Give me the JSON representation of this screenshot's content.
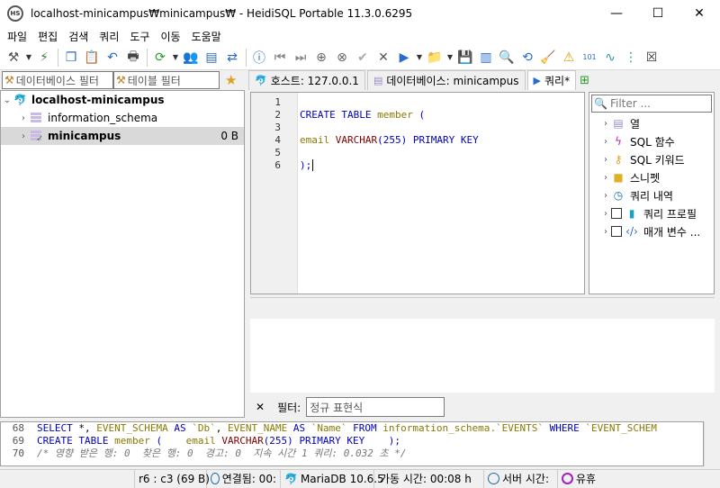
{
  "window": {
    "title": "localhost-minicampus₩minicampus₩ - HeidiSQL Portable 11.3.0.6295",
    "icon_label": "HS"
  },
  "window_controls": {
    "minimize": "—",
    "maximize": "☐",
    "close": "✕"
  },
  "menu": [
    "파일",
    "편집",
    "검색",
    "쿼리",
    "도구",
    "이동",
    "도움말"
  ],
  "left_panel": {
    "db_filter_placeholder": "데이터베이스 필터",
    "table_filter_placeholder": "테이블 필터",
    "tree": {
      "root": "localhost-minicampus",
      "items": [
        {
          "label": "information_schema",
          "size": ""
        },
        {
          "label": "minicampus",
          "size": "0 B"
        }
      ]
    }
  },
  "tabs": [
    {
      "label": "호스트: 127.0.0.1"
    },
    {
      "label": "데이터베이스: minicampus"
    },
    {
      "label": "쿼리*"
    }
  ],
  "editor": {
    "line_numbers": [
      "1",
      "2",
      "3",
      "4",
      "5",
      "6"
    ],
    "line1": "",
    "line2_kw": "CREATE TABLE",
    "line2_id": " member ",
    "line2_paren": "(",
    "line4_id": "email ",
    "line4_type": "VARCHAR",
    "line4_args": "(255) ",
    "line4_kw": "PRIMARY KEY",
    "line6": ");"
  },
  "helper": {
    "filter_placeholder": "Filter ...",
    "items": [
      {
        "label": "열"
      },
      {
        "label": "SQL 함수"
      },
      {
        "label": "SQL 키워드"
      },
      {
        "label": "스니펫"
      },
      {
        "label": "쿼리 내역"
      },
      {
        "label": "쿼리 프로필"
      },
      {
        "label": "매개 변수 ..."
      }
    ]
  },
  "filterbar": {
    "close": "✕",
    "label": "필터:",
    "placeholder": "정규 표현식"
  },
  "log": {
    "rows": [
      {
        "num": "68",
        "p1": "SELECT",
        "p2": " *, ",
        "p3": "EVENT_SCHEMA",
        "p4": " AS ",
        "p5": "`Db`",
        "p6": ", ",
        "p7": "EVENT_NAME",
        "p8": " AS ",
        "p9": "`Name`",
        "p10": " FROM ",
        "p11": "information_schema",
        "p12": ".`EVENTS` ",
        "p13": "WHERE",
        "p14": " `EVENT_SCHEM"
      },
      {
        "num": "69",
        "p1": "CREATE TABLE",
        "p2": " member ",
        "p3": "(",
        "p4": "    email ",
        "p5": "VARCHAR",
        "p6": "(255) ",
        "p7": "PRIMARY KEY",
        "p8": "    );"
      },
      {
        "num": "70",
        "text": "/* 영향 받은 행: 0  찾은 행: 0  경고: 0  지속 시간 1 쿼리: 0.032 초 */"
      }
    ]
  },
  "status": {
    "cursor": "r6 : c3 (69 B)",
    "connected": "연결됨: 00:",
    "server": "MariaDB 10.6.5",
    "uptime": "가동 시간: 00:08 h",
    "server_time": "서버 시간:",
    "idle": "유휴"
  },
  "colors": {
    "keyword": "#0000c0",
    "identifier": "#8a7a00",
    "type": "#800000",
    "selection": "#d9d9d9"
  }
}
